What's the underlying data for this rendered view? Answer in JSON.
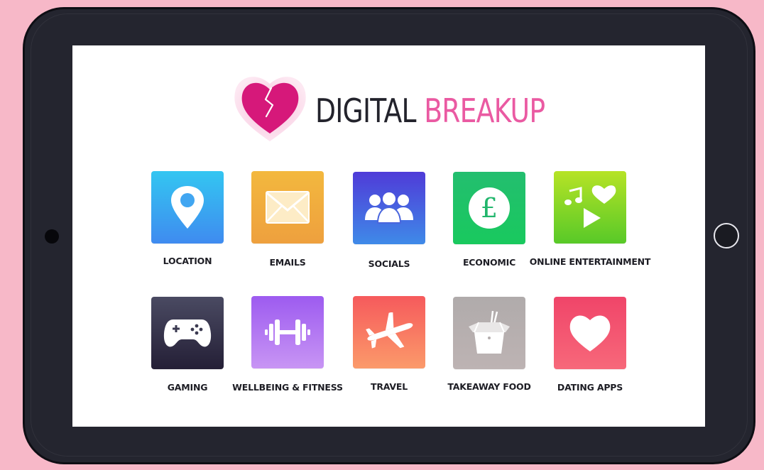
{
  "header": {
    "title_part1": "DIGITAL",
    "title_part2": "BREAKUP"
  },
  "apps": [
    {
      "label": "LOCATION",
      "icon": "location-pin-icon"
    },
    {
      "label": "EMAILS",
      "icon": "envelope-icon"
    },
    {
      "label": "SOCIALS",
      "icon": "people-group-icon"
    },
    {
      "label": "ECONOMIC",
      "icon": "pound-coin-icon"
    },
    {
      "label": "ONLINE ENTERTAINMENT",
      "icon": "music-heart-play-icon"
    },
    {
      "label": "GAMING",
      "icon": "game-controller-icon"
    },
    {
      "label": "WELLBEING & FITNESS",
      "icon": "dumbbell-icon"
    },
    {
      "label": "TRAVEL",
      "icon": "airplane-icon"
    },
    {
      "label": "TAKEAWAY FOOD",
      "icon": "takeaway-box-icon"
    },
    {
      "label": "DATING APPS",
      "icon": "heart-icon"
    }
  ],
  "colors": {
    "background": "#f7b8c8",
    "tablet_frame": "#24252f",
    "title_dark": "#23232c",
    "title_pink": "#ea5aa2",
    "logo_heart": "#d6187a"
  }
}
